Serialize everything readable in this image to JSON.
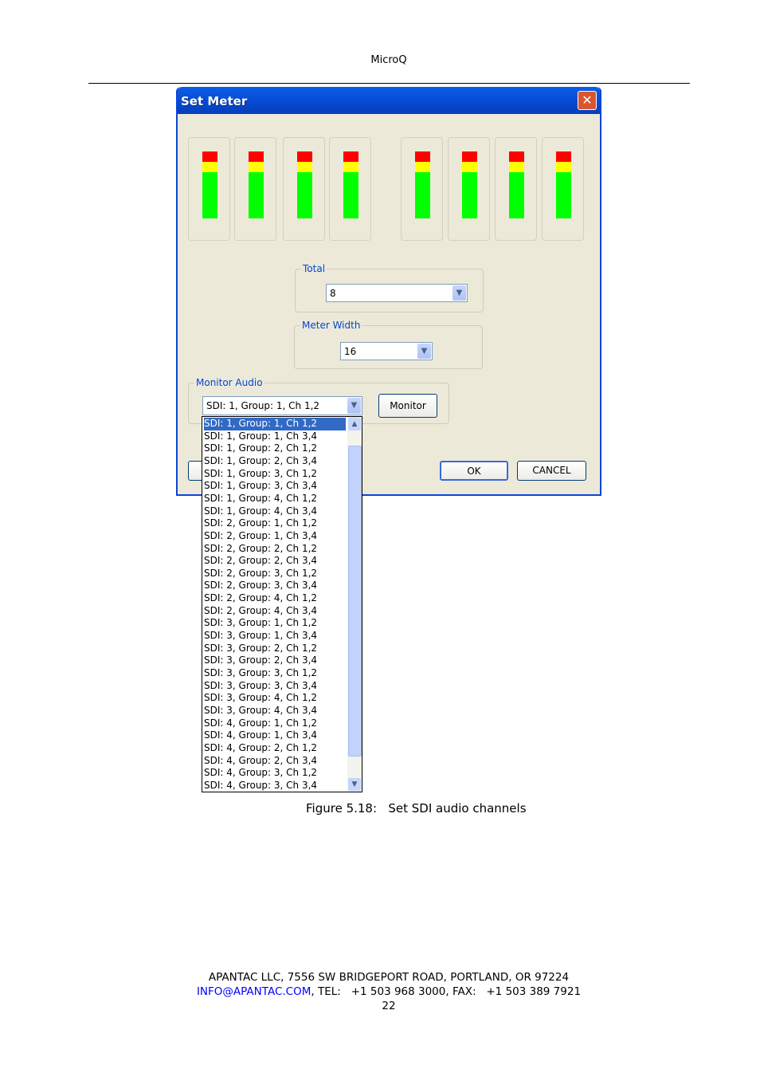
{
  "page_header": "MicroQ",
  "dialog": {
    "title": "Set Meter",
    "close_icon": "close-icon",
    "meter_colors": {
      "peak": "#ff0000",
      "warning": "#ffff00",
      "normal": "#00ff00"
    },
    "meter_count": 8,
    "total": {
      "label": "Total",
      "value": "8"
    },
    "meter_width": {
      "label": "Meter Width",
      "value": "16"
    },
    "monitor_audio": {
      "label": "Monitor Audio",
      "value": "SDI: 1, Group: 1, Ch 1,2",
      "button": "Monitor"
    },
    "ok": "OK",
    "cancel": "CANCEL",
    "options": [
      "SDI: 1, Group: 1, Ch 1,2",
      "SDI: 1, Group: 1, Ch 3,4",
      "SDI: 1, Group: 2, Ch 1,2",
      "SDI: 1, Group: 2, Ch 3,4",
      "SDI: 1, Group: 3, Ch 1,2",
      "SDI: 1, Group: 3, Ch 3,4",
      "SDI: 1, Group: 4, Ch 1,2",
      "SDI: 1, Group: 4, Ch 3,4",
      "SDI: 2, Group: 1, Ch 1,2",
      "SDI: 2, Group: 1, Ch 3,4",
      "SDI: 2, Group: 2, Ch 1,2",
      "SDI: 2, Group: 2, Ch 3,4",
      "SDI: 2, Group: 3, Ch 1,2",
      "SDI: 2, Group: 3, Ch 3,4",
      "SDI: 2, Group: 4, Ch 1,2",
      "SDI: 2, Group: 4, Ch 3,4",
      "SDI: 3, Group: 1, Ch 1,2",
      "SDI: 3, Group: 1, Ch 3,4",
      "SDI: 3, Group: 2, Ch 1,2",
      "SDI: 3, Group: 2, Ch 3,4",
      "SDI: 3, Group: 3, Ch 1,2",
      "SDI: 3, Group: 3, Ch 3,4",
      "SDI: 3, Group: 4, Ch 1,2",
      "SDI: 3, Group: 4, Ch 3,4",
      "SDI: 4, Group: 1, Ch 1,2",
      "SDI: 4, Group: 1, Ch 3,4",
      "SDI: 4, Group: 2, Ch 1,2",
      "SDI: 4, Group: 2, Ch 3,4",
      "SDI: 4, Group: 3, Ch 1,2",
      "SDI: 4, Group: 3, Ch 3,4"
    ],
    "selected_index": 0
  },
  "caption": {
    "number": "Figure 5.18:",
    "text": "Set SDI audio channels"
  },
  "footer": {
    "address": "APANTAC LLC, 7556 SW BRIDGEPORT ROAD, PORTLAND, OR 97224",
    "email": "INFO@APANTAC.COM",
    "contact": ", TEL:   +1 503 968 3000, FAX:   +1 503 389 7921",
    "page": "22"
  }
}
